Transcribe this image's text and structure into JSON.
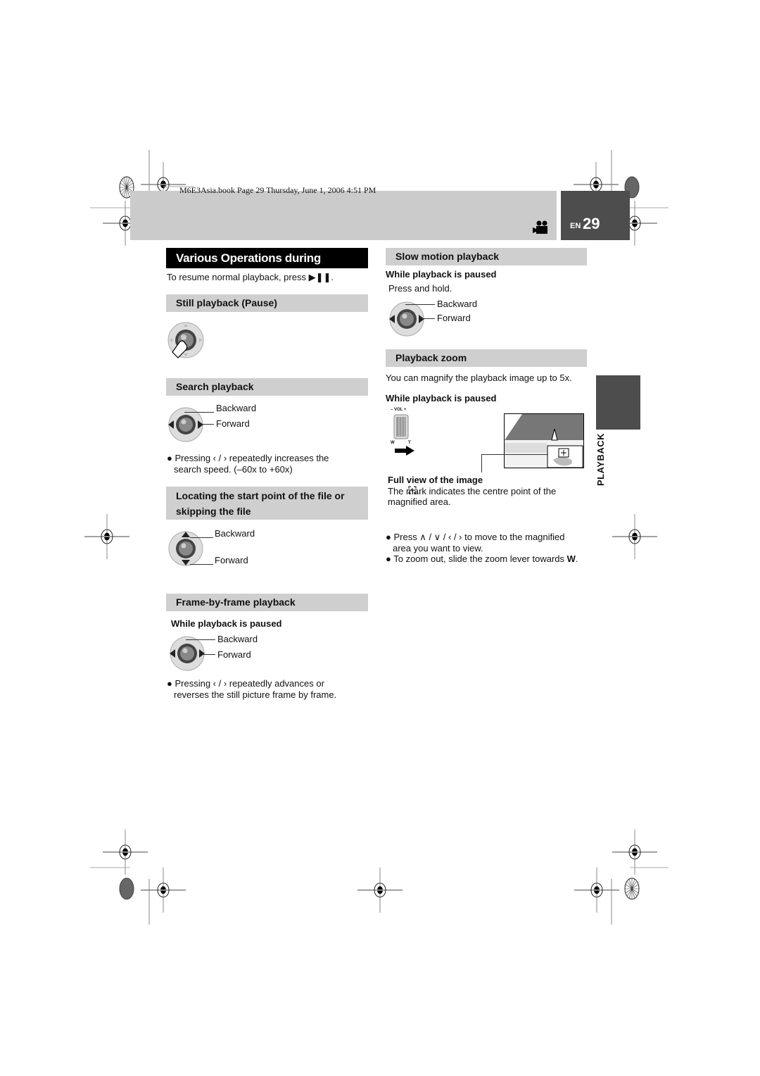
{
  "header": {
    "book_line": "M6E3Asia.book  Page 29  Thursday, June 1, 2006  4:51 PM",
    "lang": "EN",
    "page_number": "29",
    "mode_icon": "video-camera-icon"
  },
  "side_tab": {
    "label": "PLAYBACK"
  },
  "main_title": "Various Operations during Playback",
  "intro": "To resume normal playback, press ▶❚❚.",
  "left": {
    "still": {
      "title": "Still playback (Pause)"
    },
    "search": {
      "title": "Search playback",
      "backward": "Backward",
      "forward": "Forward",
      "note_a": "Pressing  ‹ / ›  repeatedly increases the",
      "note_b": "search speed. (–60x to +60x)"
    },
    "locate": {
      "title_a": "Locating the start point of the file or",
      "title_b": "skipping the file",
      "backward": "Backward",
      "forward": "Forward"
    },
    "frame": {
      "title": "Frame-by-frame playback",
      "condition": "While playback is paused",
      "backward": "Backward",
      "forward": "Forward",
      "note_a": "Pressing  ‹ / ›  repeatedly advances or",
      "note_b": "reverses the still picture frame by frame."
    }
  },
  "right": {
    "slow": {
      "title": "Slow motion playback",
      "condition": "While playback is paused",
      "instruction": "Press and hold.",
      "backward": "Backward",
      "forward": "Forward"
    },
    "zoom": {
      "title": "Playback zoom",
      "desc": "You can magnify the playback image up to 5x.",
      "condition": "While playback is paused",
      "lever_top": "– VOL +",
      "lever_w": "W",
      "lever_t": "T",
      "full_view": "Full view of the image",
      "mark_a": "The      mark indicates the centre point of the",
      "mark_b": "magnified area.",
      "note1_a": "Press  ∧ / ∨ / ‹ / ›  to move to the magnified",
      "note1_b": "area you want to view.",
      "note2_pre": "To zoom out, slide the zoom lever towards ",
      "note2_bold": "W",
      "note2_post": "."
    }
  }
}
